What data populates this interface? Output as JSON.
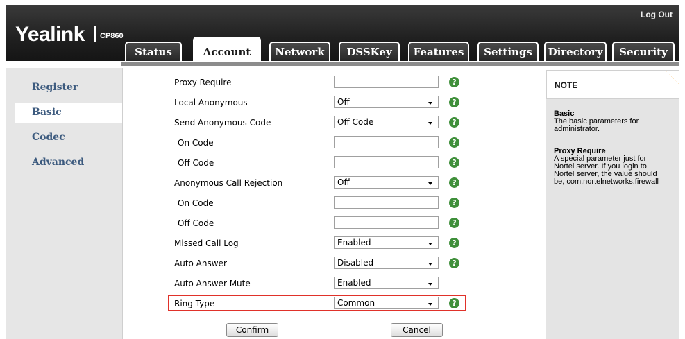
{
  "header": {
    "logo": "Yealink",
    "model": "CP860",
    "logout": "Log Out"
  },
  "tabs": [
    {
      "label": "Status"
    },
    {
      "label": "Account"
    },
    {
      "label": "Network"
    },
    {
      "label": "DSSKey"
    },
    {
      "label": "Features"
    },
    {
      "label": "Settings"
    },
    {
      "label": "Directory"
    },
    {
      "label": "Security"
    }
  ],
  "sidebar": {
    "items": [
      {
        "label": "Register"
      },
      {
        "label": "Basic"
      },
      {
        "label": "Codec"
      },
      {
        "label": "Advanced"
      }
    ],
    "active": "Basic"
  },
  "form": {
    "rows": [
      {
        "label": "Proxy Require",
        "type": "text",
        "value": ""
      },
      {
        "label": "Local Anonymous",
        "type": "select",
        "value": "Off"
      },
      {
        "label": "Send Anonymous Code",
        "type": "select",
        "value": "Off Code"
      },
      {
        "label": "On Code",
        "type": "text",
        "value": ""
      },
      {
        "label": "Off Code",
        "type": "text",
        "value": ""
      },
      {
        "label": "Anonymous Call Rejection",
        "type": "select",
        "value": "Off"
      },
      {
        "label": "On Code",
        "type": "text",
        "value": ""
      },
      {
        "label": "Off Code",
        "type": "text",
        "value": ""
      },
      {
        "label": "Missed Call Log",
        "type": "select",
        "value": "Enabled"
      },
      {
        "label": "Auto Answer",
        "type": "select",
        "value": "Disabled"
      },
      {
        "label": "Auto Answer Mute",
        "type": "select",
        "value": "Enabled"
      },
      {
        "label": "Ring Type",
        "type": "select",
        "value": "Common"
      }
    ],
    "help_glyph": "?",
    "confirm": "Confirm",
    "cancel": "Cancel"
  },
  "note": {
    "title": "NOTE",
    "sections": [
      {
        "heading": "Basic",
        "lines": [
          "The basic parameters for",
          "administrator."
        ]
      },
      {
        "heading": "Proxy Require",
        "lines": [
          "A special parameter just for",
          "Nortel server. If you login to",
          "Nortel server, the value should",
          "be, com.nortelnetworks.firewall"
        ]
      }
    ]
  },
  "colors": {
    "header_dark": "#1f1f1f",
    "nav_text": "#3c5a7e",
    "help_green": "#3f8f3a",
    "highlight_red": "#e0322a",
    "note_corner": "#f39a1a"
  }
}
